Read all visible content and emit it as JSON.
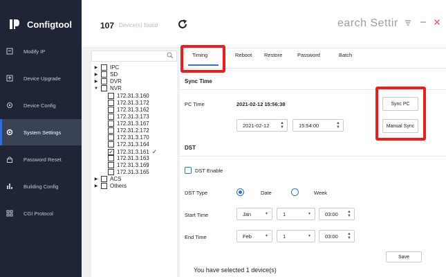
{
  "app": {
    "name": "Configtool",
    "logo_icon": "logo-icon"
  },
  "sidebar": {
    "items": [
      {
        "label": "Modify IP",
        "icon": "ip-icon"
      },
      {
        "label": "Device Upgrade",
        "icon": "upgrade-icon"
      },
      {
        "label": "Device Config",
        "icon": "config-icon"
      },
      {
        "label": "System Settings",
        "icon": "settings-icon",
        "active": true
      },
      {
        "label": "Password Reset",
        "icon": "lock-icon"
      },
      {
        "label": "Building Config",
        "icon": "building-icon"
      },
      {
        "label": "CGI Protocol",
        "icon": "protocol-icon"
      }
    ]
  },
  "topbar": {
    "device_count": "107",
    "devices_found": "Device(s) found",
    "search_text": "earch Settir"
  },
  "tree": {
    "groups": [
      "IPC",
      "SD",
      "DVR",
      "NVR"
    ],
    "nvr_ips": [
      "172.31.3.160",
      "172.31.3.172",
      "172.31.3.162",
      "172.31.3.173",
      "172.31.3.167",
      "172.31.2.172",
      "172.31.3.170",
      "172.31.3.164",
      "172.31.3.161",
      "172.31.3.163",
      "172.31.3.169",
      "172.31.3.165"
    ],
    "checked_ip": "172.31.3.161",
    "other_groups": [
      "ACS",
      "Others"
    ]
  },
  "tabs": [
    "Timing",
    "Reboot",
    "Restore",
    "Password",
    "Batch"
  ],
  "sync_time": {
    "title": "Sync Time",
    "pc_time_label": "PC Time",
    "pc_time_value": "2021-02-12 15:56:38",
    "date_value": "2021-02-12",
    "time_value": "15:54:00",
    "sync_pc_button": "Sync PC",
    "manual_sync_button": "Manual Sync"
  },
  "dst": {
    "title": "DST",
    "enable_label": "DST Enable",
    "type_label": "DST Type",
    "type_date": "Date",
    "type_week": "Week",
    "start_label": "Start Time",
    "start_month": "Jan",
    "start_day": "1",
    "start_time": "03:00",
    "end_label": "End Time",
    "end_month": "Feb",
    "end_day": "1",
    "end_time": "03:00",
    "save_button": "Save"
  },
  "footer": {
    "selected_msg": "You have selected 1 device(s)"
  },
  "colors": {
    "sidebar_bg": "#1f2536",
    "accent": "#2f6fd6",
    "highlight": "#ee1c1c"
  }
}
